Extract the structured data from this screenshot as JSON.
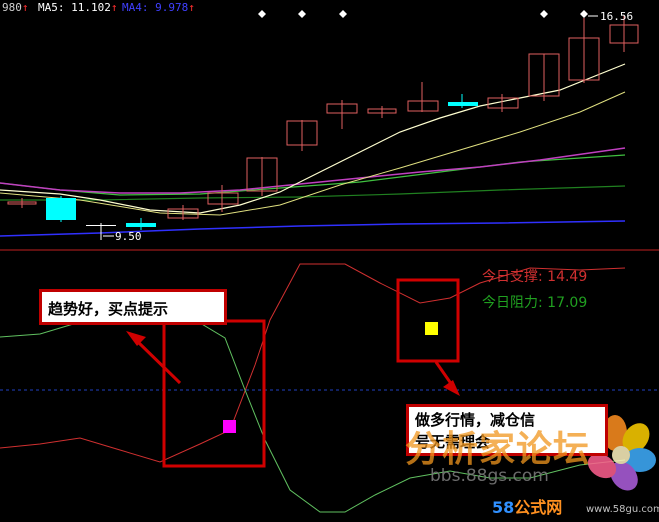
{
  "header": {
    "ma_prev": "980",
    "ma5_label": "MA5: 11.102",
    "ma_next": "MA4:  9.978",
    "arrow": "↑"
  },
  "price_labels": {
    "high": "16.56",
    "low": "9.50"
  },
  "indicator": {
    "support_label": "今日支撑: 14.49",
    "resistance_label": "今日阻力: 17.09",
    "support_color": "#d03030",
    "resistance_color": "#20a020"
  },
  "callouts": {
    "buy_signal": "趋势好，买点提示",
    "sell_signal_line1": "做多行情，减仓信",
    "sell_signal_line2": "号无需理会"
  },
  "markers": {
    "buy_color": "#ff00ff",
    "sell_color": "#ffff00"
  },
  "watermarks": {
    "forum_name": "分析家论坛",
    "forum_url": "bbs.88gs.com",
    "brand_num": "58",
    "brand_text": "公式网",
    "brand_url": "www.58gu.com"
  },
  "colors": {
    "candle_up": "#e06060",
    "candle_down": "#00ffff",
    "ma_short": "#ffffc0",
    "ma_magenta": "#c040c0",
    "ma_green": "#40c040",
    "ma_blue": "#3030ff",
    "divider": "#c02020"
  }
}
